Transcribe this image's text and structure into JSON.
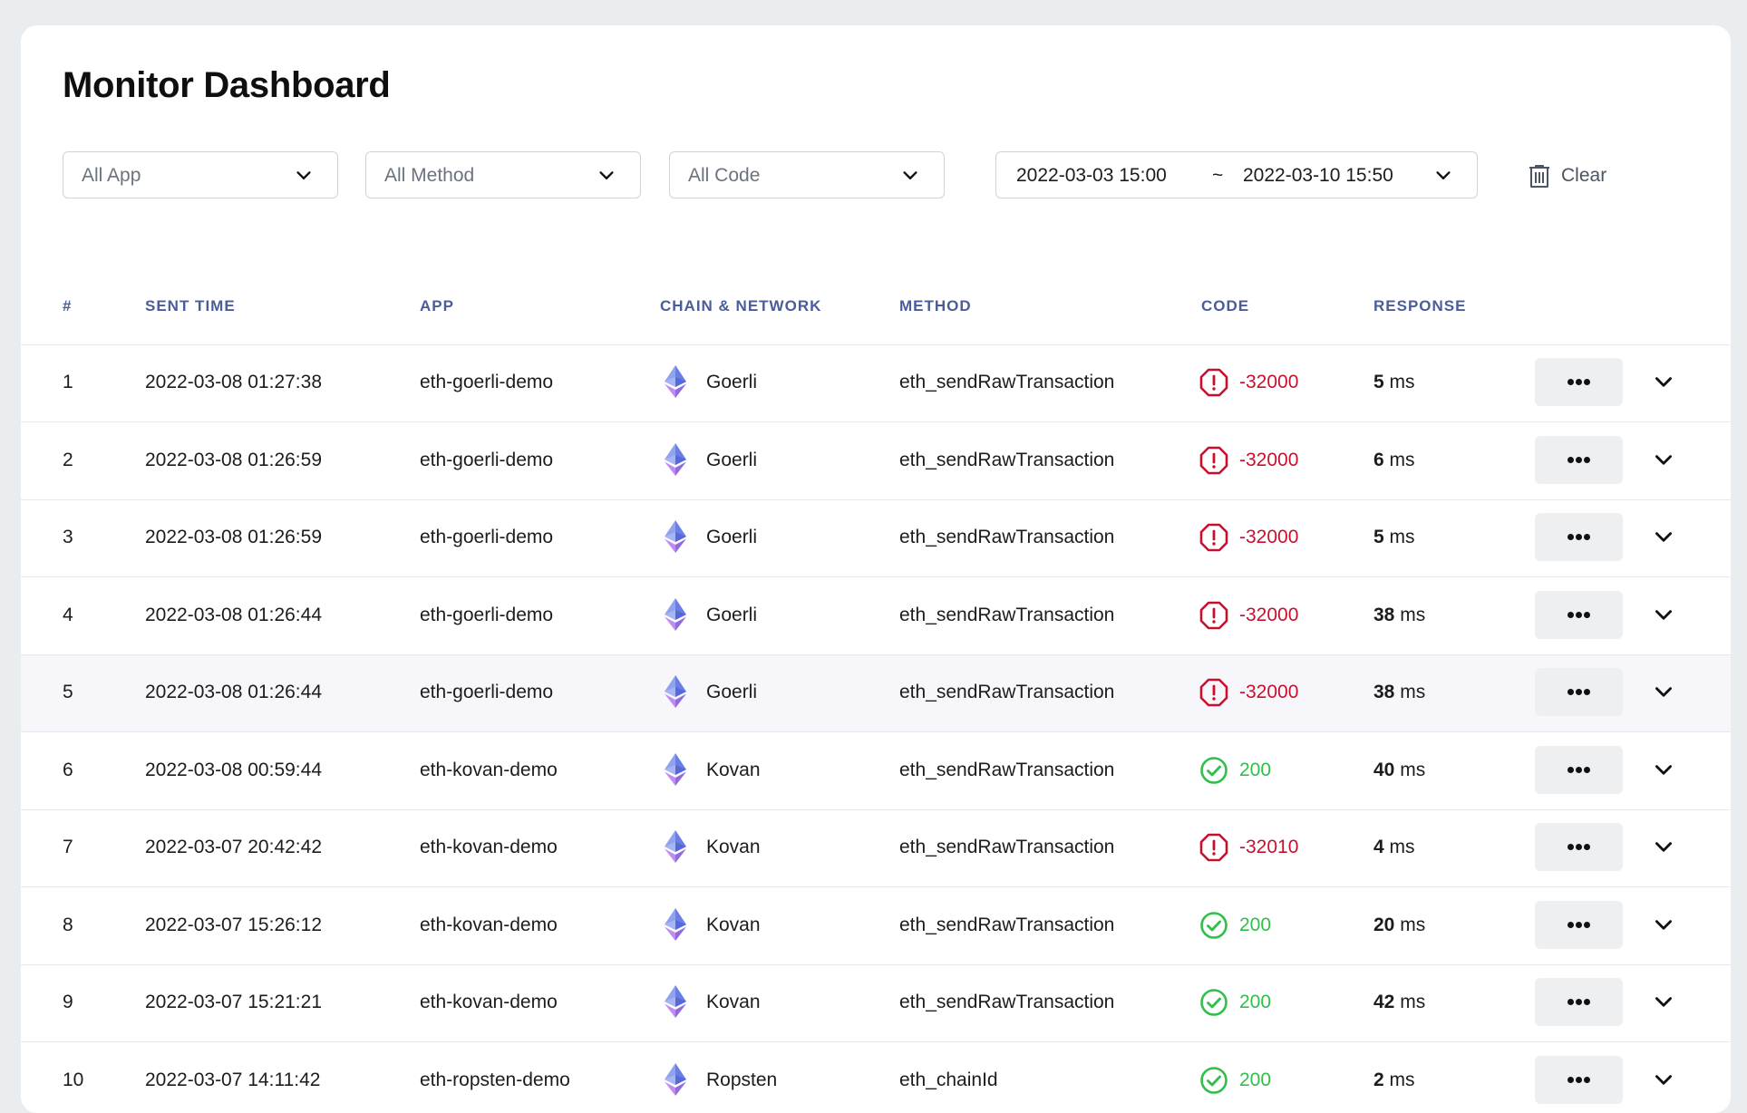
{
  "title": "Monitor Dashboard",
  "filters": {
    "app": "All App",
    "method": "All Method",
    "code": "All Code",
    "range_start": "2022-03-03 15:00",
    "range_sep": "~",
    "range_end": "2022-03-10 15:50",
    "clear": "Clear"
  },
  "columns": [
    "#",
    "SENT TIME",
    "APP",
    "CHAIN & NETWORK",
    "METHOD",
    "CODE",
    "RESPONSE"
  ],
  "response_unit": "ms",
  "rows": [
    {
      "num": "1",
      "time": "2022-03-08 01:27:38",
      "app": "eth-goerli-demo",
      "network": "Goerli",
      "method": "eth_sendRawTransaction",
      "code": "-32000",
      "status": "error",
      "response": "5"
    },
    {
      "num": "2",
      "time": "2022-03-08 01:26:59",
      "app": "eth-goerli-demo",
      "network": "Goerli",
      "method": "eth_sendRawTransaction",
      "code": "-32000",
      "status": "error",
      "response": "6"
    },
    {
      "num": "3",
      "time": "2022-03-08 01:26:59",
      "app": "eth-goerli-demo",
      "network": "Goerli",
      "method": "eth_sendRawTransaction",
      "code": "-32000",
      "status": "error",
      "response": "5"
    },
    {
      "num": "4",
      "time": "2022-03-08 01:26:44",
      "app": "eth-goerli-demo",
      "network": "Goerli",
      "method": "eth_sendRawTransaction",
      "code": "-32000",
      "status": "error",
      "response": "38"
    },
    {
      "num": "5",
      "time": "2022-03-08 01:26:44",
      "app": "eth-goerli-demo",
      "network": "Goerli",
      "method": "eth_sendRawTransaction",
      "code": "-32000",
      "status": "error",
      "response": "38",
      "highlighted": true
    },
    {
      "num": "6",
      "time": "2022-03-08 00:59:44",
      "app": "eth-kovan-demo",
      "network": "Kovan",
      "method": "eth_sendRawTransaction",
      "code": "200",
      "status": "ok",
      "response": "40"
    },
    {
      "num": "7",
      "time": "2022-03-07 20:42:42",
      "app": "eth-kovan-demo",
      "network": "Kovan",
      "method": "eth_sendRawTransaction",
      "code": "-32010",
      "status": "error",
      "response": "4"
    },
    {
      "num": "8",
      "time": "2022-03-07 15:26:12",
      "app": "eth-kovan-demo",
      "network": "Kovan",
      "method": "eth_sendRawTransaction",
      "code": "200",
      "status": "ok",
      "response": "20"
    },
    {
      "num": "9",
      "time": "2022-03-07 15:21:21",
      "app": "eth-kovan-demo",
      "network": "Kovan",
      "method": "eth_sendRawTransaction",
      "code": "200",
      "status": "ok",
      "response": "42"
    },
    {
      "num": "10",
      "time": "2022-03-07 14:11:42",
      "app": "eth-ropsten-demo",
      "network": "Ropsten",
      "method": "eth_chainId",
      "code": "200",
      "status": "ok",
      "response": "2"
    }
  ],
  "colors": {
    "error": "#c8102e",
    "ok": "#2fbf4a",
    "header": "#4a5d9b",
    "highlight": "#f7f7fb"
  },
  "icons": {
    "network": "ethereum-icon",
    "error": "alert-octagon-icon",
    "ok": "check-circle-icon",
    "more": "more-horizontal-icon",
    "expand": "chevron-down-icon",
    "clear": "trash-icon",
    "dropdown": "chevron-down-icon"
  }
}
